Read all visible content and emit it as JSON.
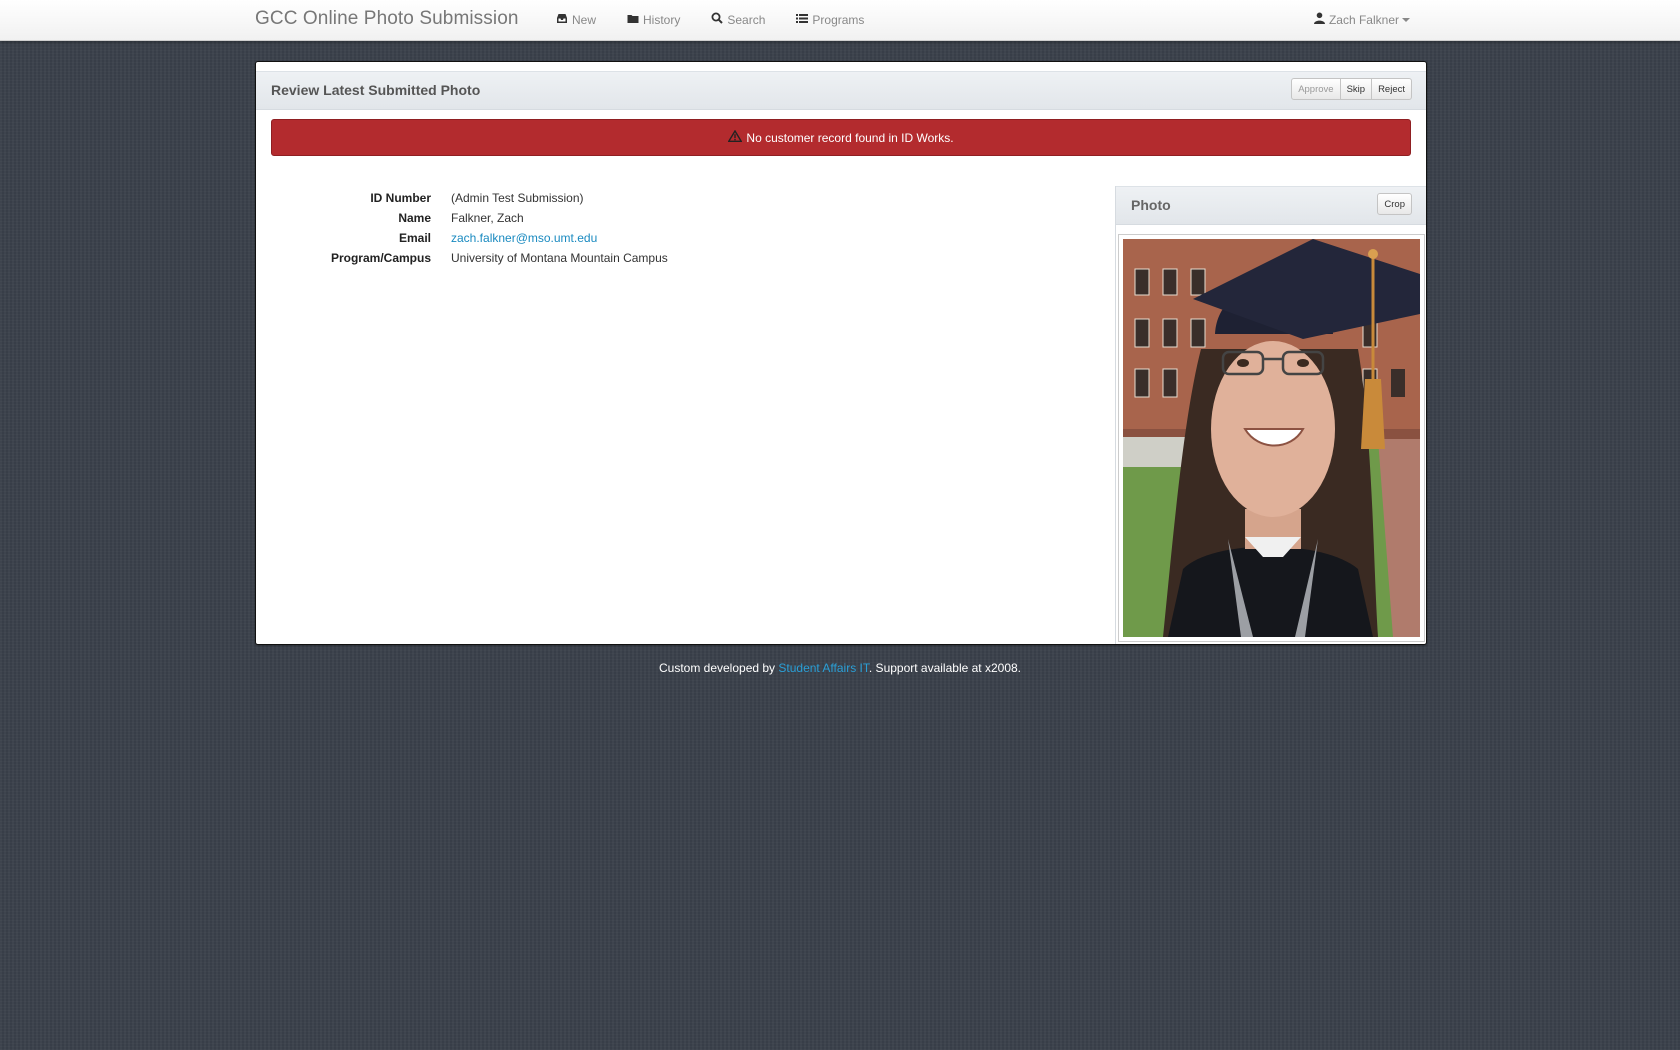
{
  "navbar": {
    "brand": "GCC Online Photo Submission",
    "items": [
      {
        "label": "New",
        "icon": "inbox-icon"
      },
      {
        "label": "History",
        "icon": "folder-icon"
      },
      {
        "label": "Search",
        "icon": "search-icon"
      },
      {
        "label": "Programs",
        "icon": "list-icon"
      }
    ],
    "user": {
      "name": "Zach Falkner",
      "icon": "user-icon"
    }
  },
  "review": {
    "title": "Review Latest Submitted Photo",
    "actions": {
      "approve": "Approve",
      "skip": "Skip",
      "reject": "Reject"
    },
    "alert": "No customer record found in ID Works.",
    "fields": [
      {
        "label": "ID Number",
        "value": "(Admin Test Submission)"
      },
      {
        "label": "Name",
        "value": "Falkner, Zach"
      },
      {
        "label": "Email",
        "value": "zach.falkner@mso.umt.edu"
      },
      {
        "label": "Program/Campus",
        "value": "University of Montana Mountain Campus"
      }
    ]
  },
  "photo": {
    "title": "Photo",
    "crop_label": "Crop"
  },
  "footer": {
    "prefix": "Custom developed by ",
    "link": "Student Affairs IT",
    "suffix": ". Support available at x2008."
  },
  "colors": {
    "alert": "#b32b2e",
    "link": "#1a8ac0",
    "background": "#3b414b"
  }
}
